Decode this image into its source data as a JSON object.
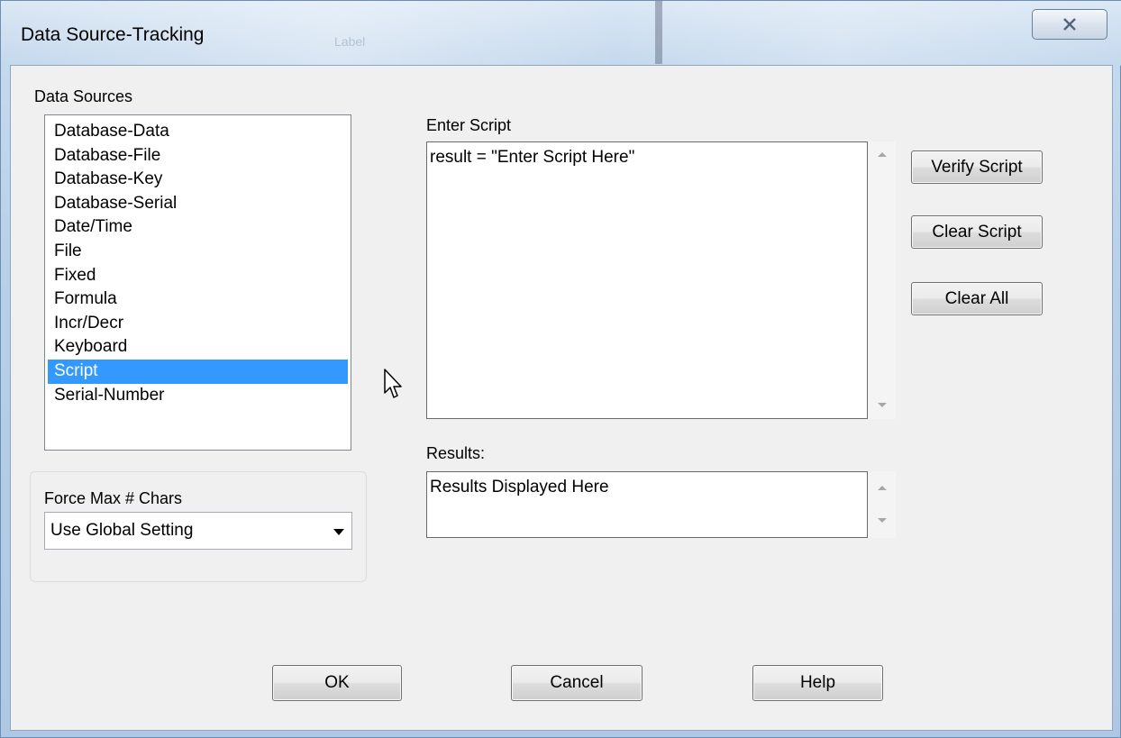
{
  "window": {
    "title": "Data Source-Tracking",
    "close_glyph": "⌧"
  },
  "data_sources": {
    "label": "Data Sources",
    "items": [
      "Database-Data",
      "Database-File",
      "Database-Key",
      "Database-Serial",
      "Date/Time",
      "File",
      "Fixed",
      "Formula",
      "Incr/Decr",
      "Keyboard",
      "Script",
      "Serial-Number"
    ],
    "selected": "Script"
  },
  "force_max": {
    "label": "Force Max # Chars",
    "value": "Use Global Setting"
  },
  "script": {
    "label": "Enter Script",
    "value": "result = \"Enter Script Here\""
  },
  "results": {
    "label": "Results:",
    "value": "Results Displayed Here"
  },
  "buttons": {
    "verify": "Verify Script",
    "clear_script": "Clear Script",
    "clear_all": "Clear All",
    "ok": "OK",
    "cancel": "Cancel",
    "help": "Help"
  },
  "colors": {
    "selection": "#3399ff",
    "dialog_bg": "#f0f0f0"
  }
}
